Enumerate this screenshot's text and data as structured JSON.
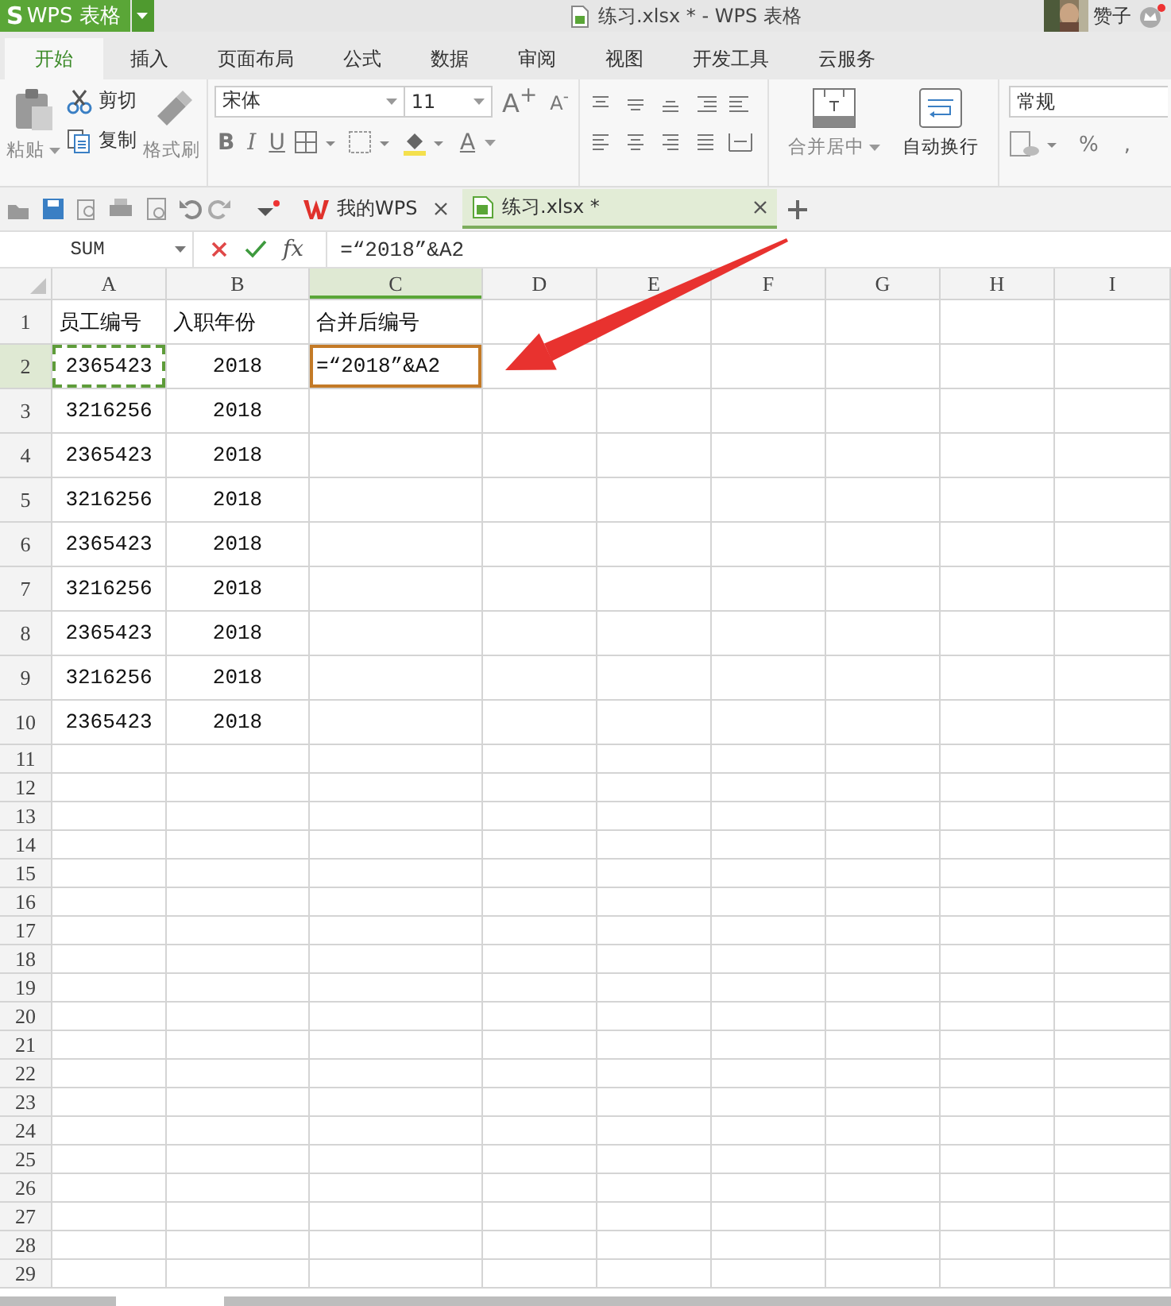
{
  "title_bar": {
    "app_menu": {
      "logo": "S",
      "label": "WPS 表格"
    },
    "title": "练习.xlsx * - WPS 表格",
    "user_name": "赞子"
  },
  "ribbon_tabs": [
    {
      "label": "开始",
      "selected": true
    },
    {
      "label": "插入",
      "selected": false
    },
    {
      "label": "页面布局",
      "selected": false
    },
    {
      "label": "公式",
      "selected": false
    },
    {
      "label": "数据",
      "selected": false
    },
    {
      "label": "审阅",
      "selected": false
    },
    {
      "label": "视图",
      "selected": false
    },
    {
      "label": "开发工具",
      "selected": false
    },
    {
      "label": "云服务",
      "selected": false
    }
  ],
  "ribbon": {
    "paste": "粘贴",
    "cut": "剪切",
    "copy": "复制",
    "format_painter": "格式刷",
    "font_name": "宋体",
    "font_size": "11",
    "grow_font": "A$^{+}$",
    "shrink_font": "A$^{-}$",
    "bold": "B",
    "italic": "I",
    "underline": "U",
    "font_color": "A",
    "merge_center": "合并居中",
    "wrap_text": "自动换行",
    "number_format": "常规",
    "percent": "%",
    "comma": ","
  },
  "doc_tabs": [
    {
      "label": "我的WPS",
      "kind": "home",
      "selected": false
    },
    {
      "label": "练习.xlsx *",
      "kind": "sheet",
      "selected": true
    }
  ],
  "formula_bar": {
    "name_box": "SUM",
    "fx": "fx",
    "formula": "=“2018”&A2"
  },
  "sheet": {
    "columns": [
      {
        "label": "A",
        "selected": false
      },
      {
        "label": "B",
        "selected": false
      },
      {
        "label": "C",
        "selected": true
      },
      {
        "label": "D",
        "selected": false
      },
      {
        "label": "E",
        "selected": false
      },
      {
        "label": "F",
        "selected": false
      },
      {
        "label": "G",
        "selected": false
      },
      {
        "label": "H",
        "selected": false
      },
      {
        "label": "I",
        "selected": false
      }
    ],
    "rows": [
      {
        "number": "1",
        "selected": false,
        "cells": [
          {
            "text": "员工编号",
            "kind": "text",
            "marquee": false,
            "editing": false
          },
          {
            "text": "入职年份",
            "kind": "text",
            "marquee": false,
            "editing": false
          },
          {
            "text": "合并后编号",
            "kind": "text",
            "marquee": false,
            "editing": false
          }
        ]
      },
      {
        "number": "2",
        "selected": true,
        "cells": [
          {
            "text": "2365423",
            "kind": "number",
            "marquee": true,
            "editing": false
          },
          {
            "text": "2018",
            "kind": "number",
            "marquee": false,
            "editing": false
          },
          {
            "text": "=“2018”&A2",
            "kind": "text",
            "marquee": false,
            "editing": true
          }
        ]
      },
      {
        "number": "3",
        "selected": false,
        "cells": [
          {
            "text": "3216256",
            "kind": "number",
            "marquee": false,
            "editing": false
          },
          {
            "text": "2018",
            "kind": "number",
            "marquee": false,
            "editing": false
          }
        ]
      },
      {
        "number": "4",
        "selected": false,
        "cells": [
          {
            "text": "2365423",
            "kind": "number",
            "marquee": false,
            "editing": false
          },
          {
            "text": "2018",
            "kind": "number",
            "marquee": false,
            "editing": false
          }
        ]
      },
      {
        "number": "5",
        "selected": false,
        "cells": [
          {
            "text": "3216256",
            "kind": "number",
            "marquee": false,
            "editing": false
          },
          {
            "text": "2018",
            "kind": "number",
            "marquee": false,
            "editing": false
          }
        ]
      },
      {
        "number": "6",
        "selected": false,
        "cells": [
          {
            "text": "2365423",
            "kind": "number",
            "marquee": false,
            "editing": false
          },
          {
            "text": "2018",
            "kind": "number",
            "marquee": false,
            "editing": false
          }
        ]
      },
      {
        "number": "7",
        "selected": false,
        "cells": [
          {
            "text": "3216256",
            "kind": "number",
            "marquee": false,
            "editing": false
          },
          {
            "text": "2018",
            "kind": "number",
            "marquee": false,
            "editing": false
          }
        ]
      },
      {
        "number": "8",
        "selected": false,
        "cells": [
          {
            "text": "2365423",
            "kind": "number",
            "marquee": false,
            "editing": false
          },
          {
            "text": "2018",
            "kind": "number",
            "marquee": false,
            "editing": false
          }
        ]
      },
      {
        "number": "9",
        "selected": false,
        "cells": [
          {
            "text": "3216256",
            "kind": "number",
            "marquee": false,
            "editing": false
          },
          {
            "text": "2018",
            "kind": "number",
            "marquee": false,
            "editing": false
          }
        ]
      },
      {
        "number": "10",
        "selected": false,
        "cells": [
          {
            "text": "2365423",
            "kind": "number",
            "marquee": false,
            "editing": false
          },
          {
            "text": "2018",
            "kind": "number",
            "marquee": false,
            "editing": false
          }
        ]
      },
      {
        "number": "11",
        "selected": false
      },
      {
        "number": "12",
        "selected": false
      },
      {
        "number": "13",
        "selected": false
      },
      {
        "number": "14",
        "selected": false
      },
      {
        "number": "15",
        "selected": false
      },
      {
        "number": "16",
        "selected": false
      },
      {
        "number": "17",
        "selected": false
      },
      {
        "number": "18",
        "selected": false
      },
      {
        "number": "19",
        "selected": false
      },
      {
        "number": "20",
        "selected": false
      },
      {
        "number": "21",
        "selected": false
      },
      {
        "number": "22",
        "selected": false
      },
      {
        "number": "23",
        "selected": false
      },
      {
        "number": "24",
        "selected": false
      },
      {
        "number": "25",
        "selected": false
      },
      {
        "number": "26",
        "selected": false
      },
      {
        "number": "27",
        "selected": false
      },
      {
        "number": "28",
        "selected": false
      },
      {
        "number": "29",
        "selected": false
      }
    ]
  }
}
